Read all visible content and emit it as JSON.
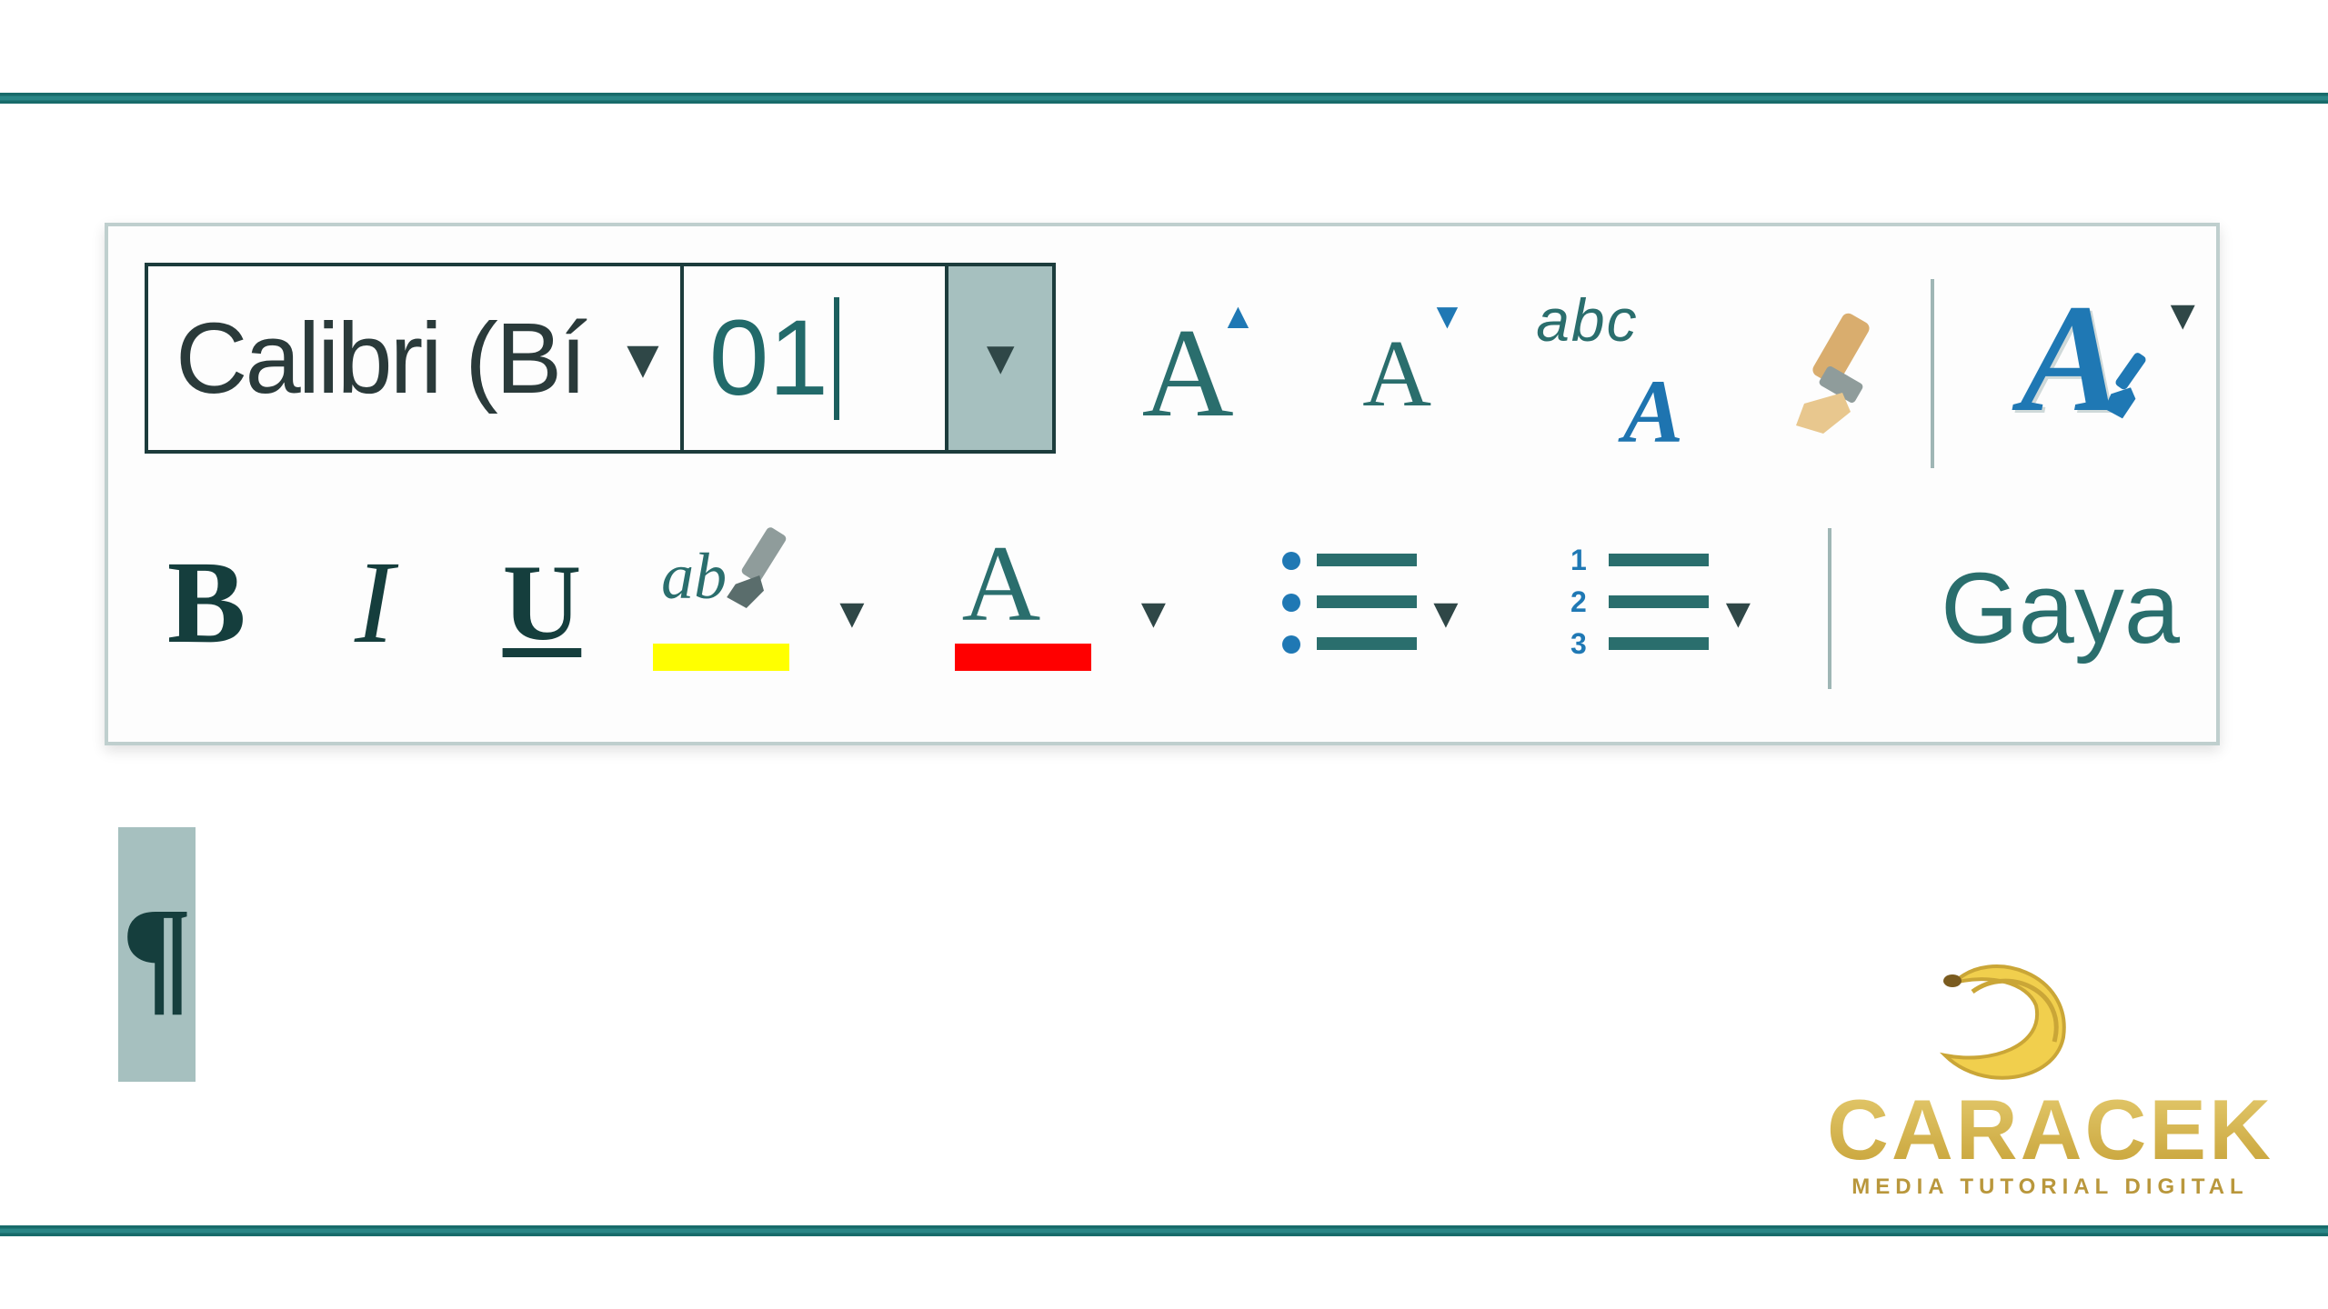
{
  "toolbar": {
    "font_name": "Calibri (Bí",
    "font_size": "01",
    "styles_label": "Gaya",
    "highlight_text": "ab",
    "change_case_label": "abc"
  },
  "document": {
    "paragraph_mark": "¶"
  },
  "watermark": {
    "brand": "CARACEK",
    "tagline": "MEDIA TUTORIAL DIGITAL"
  },
  "colors": {
    "highlight": "#ffff00",
    "font_color": "#ff0000",
    "accent": "#1f78b4",
    "teal": "#2a6e6d"
  }
}
